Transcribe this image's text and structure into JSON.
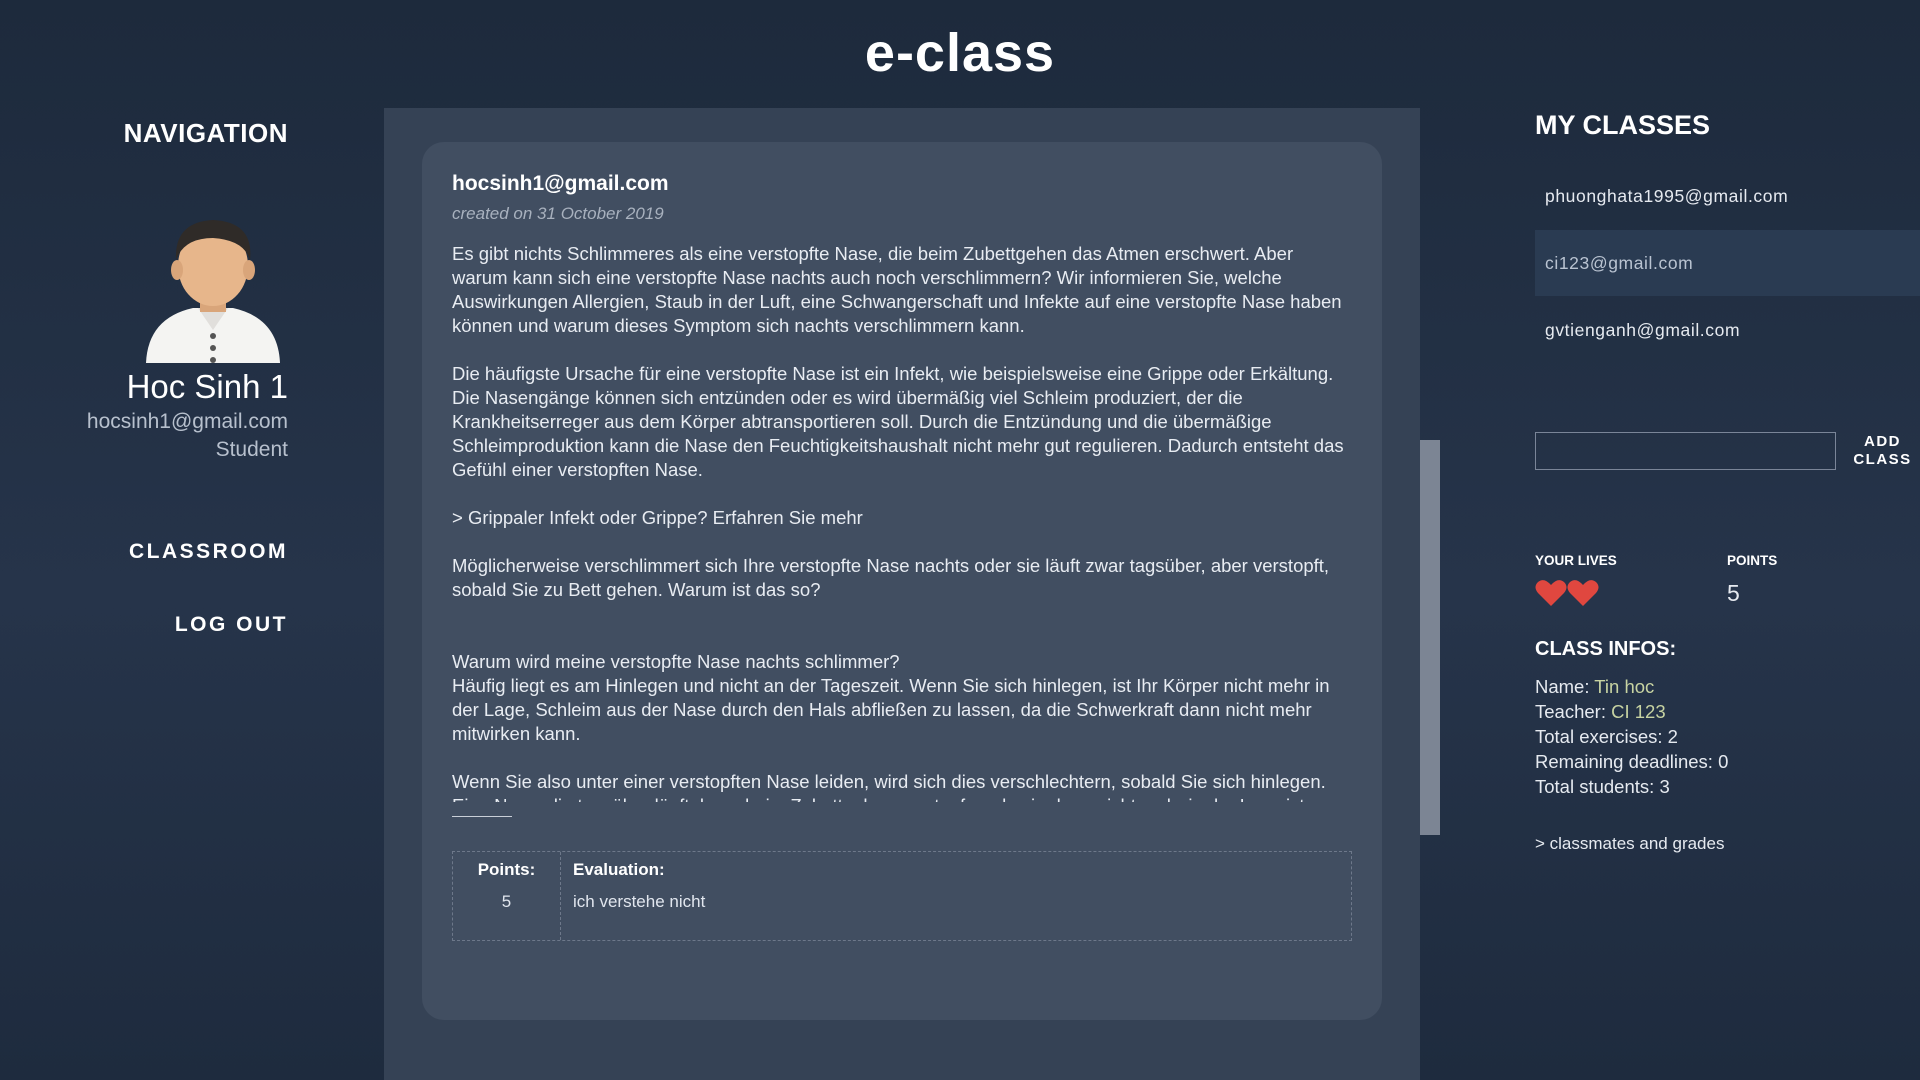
{
  "app": {
    "title": "e-class"
  },
  "nav": {
    "heading": "NAVIGATION",
    "user": {
      "name": "Hoc Sinh 1",
      "email": "hocsinh1@gmail.com",
      "role": "Student"
    },
    "links": {
      "classroom": "CLASSROOM",
      "logout": "LOG OUT"
    }
  },
  "post": {
    "author": "hocsinh1@gmail.com",
    "date": "created on 31 October 2019",
    "paragraphs": [
      "Es gibt nichts Schlimmeres als eine verstopfte Nase, die beim Zubettgehen das Atmen erschwert. Aber warum kann sich eine verstopfte Nase nachts auch noch verschlimmern? Wir informieren Sie, welche Auswirkungen Allergien, Staub in der Luft, eine Schwangerschaft und Infekte auf eine verstopfte Nase haben können und warum dieses Symptom sich nachts verschlimmern kann.",
      "Die häufigste Ursache für eine verstopfte Nase ist ein Infekt, wie beispielsweise eine Grippe oder Erkältung. Die Nasengänge können sich entzünden oder es wird übermäßig viel Schleim produziert, der die Krankheitserreger aus dem Körper abtransportieren soll. Durch die Entzündung und die übermäßige Schleimproduktion kann die Nase den Feuchtigkeitshaushalt nicht mehr gut regulieren. Dadurch entsteht das Gefühl einer verstopften Nase.",
      "> Grippaler Infekt oder Grippe? Erfahren Sie mehr",
      "Möglicherweise verschlimmert sich Ihre verstopfte Nase nachts oder sie läuft zwar tagsüber, aber verstopft, sobald Sie zu Bett gehen. Warum ist das so?",
      "Warum wird meine verstopfte Nase nachts schlimmer?",
      "Häufig liegt es am Hinlegen und nicht an der Tageszeit. Wenn Sie sich hinlegen, ist Ihr Körper nicht mehr in der Lage, Schleim aus der Nase durch den Hals abfließen zu lassen, da die Schwerkraft dann nicht mehr mitwirken kann.",
      "Wenn Sie also unter einer verstopften Nase leiden, wird sich dies verschlechtern, sobald Sie sich hinlegen. Eine Nase, die tagsüber läuft, kann beim Zubettgehen verstopfen, da sie dann nicht mehr in der Lage ist"
    ],
    "grade": {
      "points_label": "Points:",
      "points_value": "5",
      "evaluation_label": "Evaluation:",
      "evaluation_value": "ich verstehe nicht"
    }
  },
  "sidebar": {
    "title": "MY CLASSES",
    "classes": [
      "phuonghata1995@gmail.com",
      "ci123@gmail.com",
      "gvtienganh@gmail.com"
    ],
    "active_index": 1,
    "add_class": {
      "placeholder": "",
      "button": "ADD CLASS"
    },
    "stats": {
      "lives_label": "YOUR LIVES",
      "lives": 2,
      "points_label": "POINTS",
      "points": "5"
    },
    "info": {
      "title": "CLASS INFOS:",
      "name_label": "Name: ",
      "name": "Tin hoc",
      "teacher_label": "Teacher: ",
      "teacher": "CI 123",
      "exercises_label": "Total exercises: ",
      "exercises": "2",
      "deadlines_label": "Remaining deadlines: ",
      "deadlines": "0",
      "students_label": "Total students: ",
      "students": "3"
    },
    "classmates_link": "> classmates and grades"
  },
  "colors": {
    "heart": "#e0473f",
    "panel": "#354255",
    "card": "#414e61",
    "background": "#1d2a3c"
  }
}
